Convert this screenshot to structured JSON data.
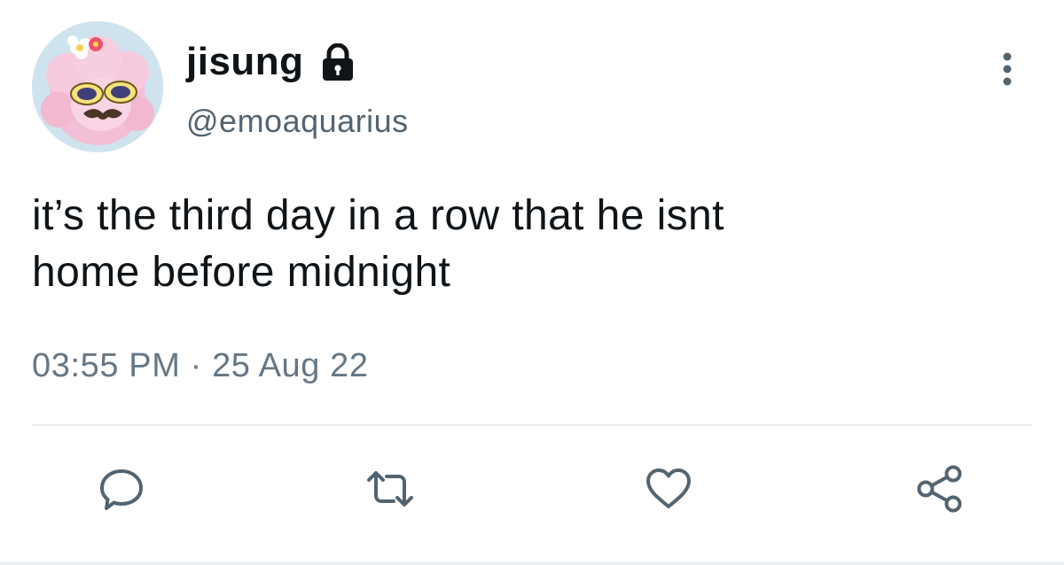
{
  "user": {
    "display_name": "jisung",
    "handle": "@emoaquarius",
    "protected_icon": "lock-icon",
    "avatar_icon": "avatar-image"
  },
  "tweet": {
    "text": "it’s the third day in a row that he isnt\nhome before midnight",
    "time": "03:55 PM",
    "separator": "·",
    "date": "25 Aug 22"
  },
  "actions": {
    "reply_icon": "reply-icon",
    "retweet_icon": "retweet-icon",
    "like_icon": "heart-icon",
    "share_icon": "share-icon",
    "more_icon": "more-options-icon"
  },
  "colors": {
    "text_primary": "#0f1419",
    "text_secondary": "#657786",
    "icon": "#536471",
    "divider": "#e6ecf0"
  }
}
